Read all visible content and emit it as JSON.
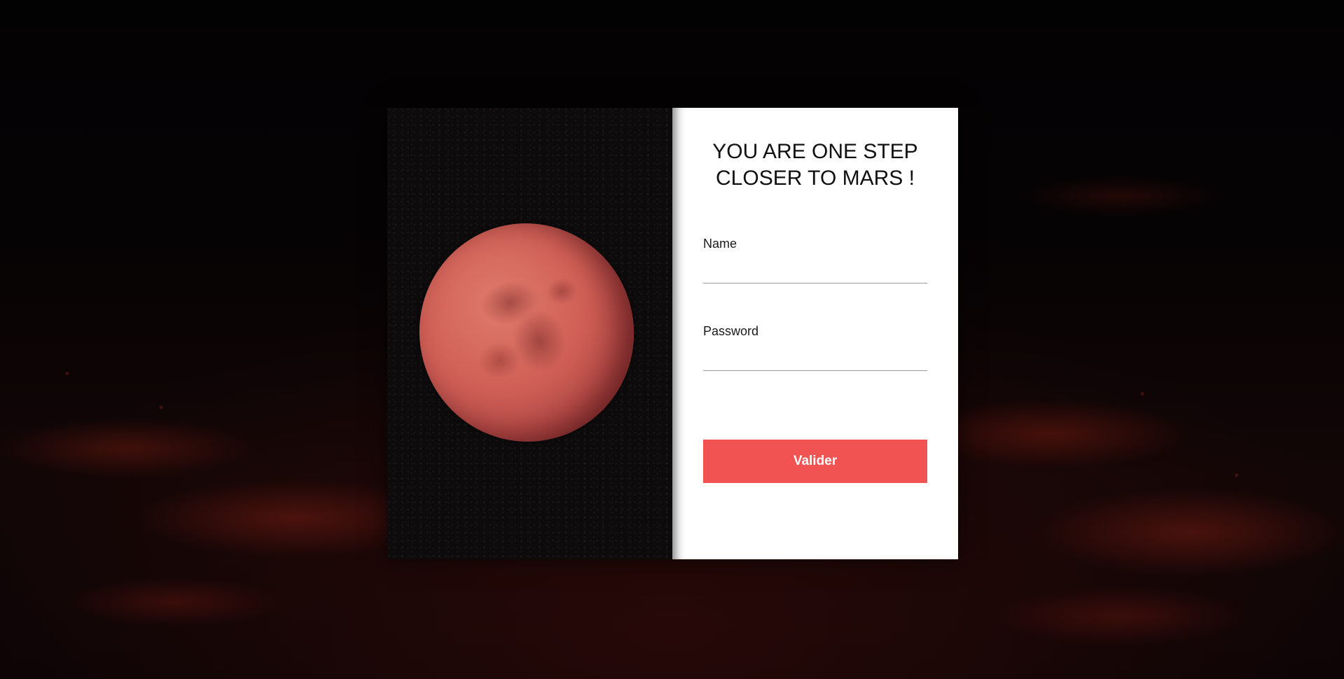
{
  "page": {
    "title": "YOU ARE ONE STEP\nCLOSER TO MARS !"
  },
  "form": {
    "name_label": "Name",
    "name_value": "",
    "password_label": "Password",
    "password_value": "",
    "submit_label": "Valider"
  },
  "colors": {
    "accent": "#f15352",
    "card_background": "#ffffff",
    "page_background": "#050304"
  }
}
